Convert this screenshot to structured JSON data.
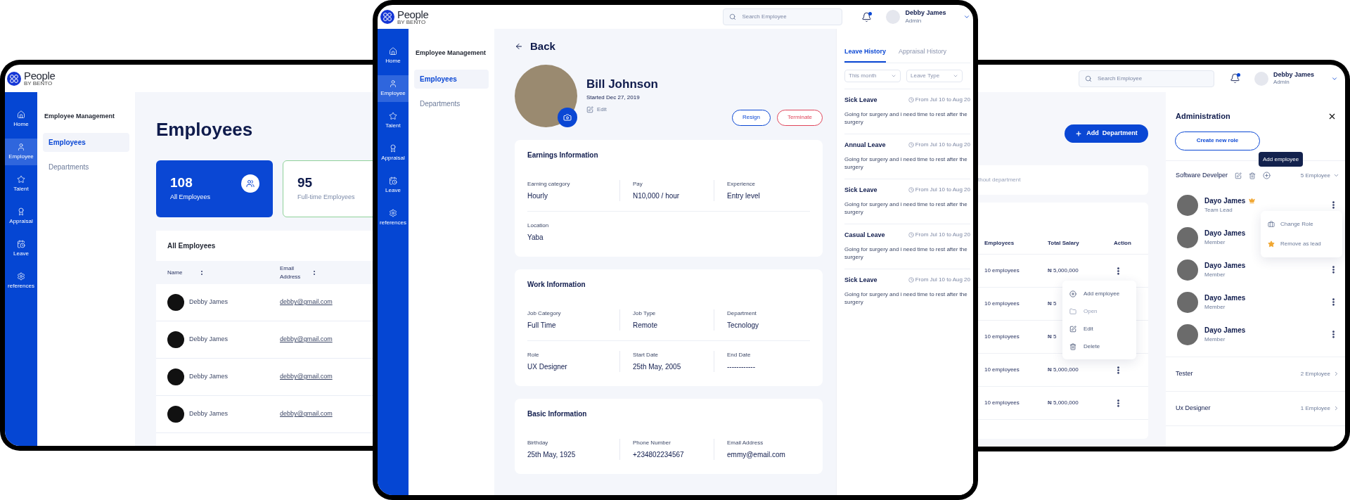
{
  "employees_screen": {
    "brand": {
      "name": "People",
      "tagline": "BY BENTO"
    },
    "nav": [
      {
        "label": "Home",
        "selected": false
      },
      {
        "label": "Employee",
        "selected": true
      },
      {
        "label": "Talent",
        "selected": false
      },
      {
        "label": "Appraisal",
        "selected": false
      },
      {
        "label": "Leave",
        "selected": false
      },
      {
        "label": "references",
        "selected": false
      }
    ],
    "subnav": {
      "title": "Employee Management",
      "items": [
        {
          "label": "Employees",
          "selected": true
        },
        {
          "label": "Departments",
          "selected": false
        }
      ]
    },
    "title": "Employees",
    "stats": [
      {
        "value": "108",
        "label": "All Employees",
        "kind": "primary"
      },
      {
        "value": "95",
        "label": "Full-time Employees",
        "kind": "outline"
      }
    ],
    "table": {
      "title": "All Employees",
      "columns": [
        "Name",
        "Email Address"
      ],
      "rows": [
        {
          "name": "Debby James",
          "email": "debby@gmail.com"
        },
        {
          "name": "Debby James",
          "email": "debby@gmail.com"
        },
        {
          "name": "Debby James",
          "email": "debby@gmail.com"
        },
        {
          "name": "Debby James",
          "email": "debby@gmail.com"
        }
      ]
    }
  },
  "profile_screen": {
    "brand": {
      "name": "People",
      "tagline": "BY BENTO"
    },
    "search": {
      "placeholder": "Search Employee"
    },
    "user": {
      "name": "Debby James",
      "role": "Admin",
      "notification": true
    },
    "nav": [
      {
        "label": "Home",
        "selected": false
      },
      {
        "label": "Employee",
        "selected": true
      },
      {
        "label": "Talent",
        "selected": false
      },
      {
        "label": "Appraisal",
        "selected": false
      },
      {
        "label": "Leave",
        "selected": false
      },
      {
        "label": "references",
        "selected": false
      }
    ],
    "subnav": {
      "title": "Employee Management",
      "items": [
        {
          "label": "Employees",
          "selected": true
        },
        {
          "label": "Departments",
          "selected": false
        }
      ]
    },
    "back": "Back",
    "profile": {
      "name": "Bill Johnson",
      "started": "Started Dec 27, 2019",
      "edit": "Edit"
    },
    "actions": [
      {
        "label": "Resign",
        "kind": "neutral"
      },
      {
        "label": "Terminate",
        "kind": "danger"
      }
    ],
    "sections": [
      {
        "title": "Earnings Information",
        "rows": [
          [
            {
              "label": "Earning category",
              "value": "Hourly"
            },
            {
              "label": "Pay",
              "value": "N10,000 / hour"
            },
            {
              "label": "Experience",
              "value": "Entry level"
            }
          ],
          [
            {
              "label": "Location",
              "value": "Yaba"
            }
          ]
        ]
      },
      {
        "title": "Work Information",
        "rows": [
          [
            {
              "label": "Job Category",
              "value": "Full Time"
            },
            {
              "label": "Job Type",
              "value": "Remote"
            },
            {
              "label": "Department",
              "value": "Tecnology"
            }
          ],
          [
            {
              "label": "Role",
              "value": "UX Designer"
            },
            {
              "label": "Start Date",
              "value": "25th May, 2005"
            },
            {
              "label": "End Date",
              "value": "------------"
            }
          ]
        ]
      },
      {
        "title": "Basic Information",
        "rows": [
          [
            {
              "label": "Birthday",
              "value": "25th May, 1925"
            },
            {
              "label": "Phone Number",
              "value": "+234802234567"
            },
            {
              "label": "Email Address",
              "value": "emmy@email.com"
            }
          ]
        ]
      }
    ],
    "history": {
      "tabs": [
        {
          "label": "Leave History",
          "selected": true
        },
        {
          "label": "Appraisal History",
          "selected": false
        }
      ],
      "filters": [
        {
          "placeholder": "This month"
        },
        {
          "placeholder": "Leave Type"
        }
      ],
      "entries": [
        {
          "type": "Sick Leave",
          "dates": "From Jul 10 to Aug 20",
          "note": "Going for surgery and i need time to rest after the surgery"
        },
        {
          "type": "Annual Leave",
          "dates": "From Jul 10 to Aug 20",
          "note": "Going for surgery and i need time to rest after the surgery"
        },
        {
          "type": "Sick Leave",
          "dates": "From Jul 10 to Aug 20",
          "note": "Going for surgery and i need time to rest after the surgery"
        },
        {
          "type": "Casual Leave",
          "dates": "From Jul 10 to Aug 20",
          "note": "Going for surgery and i need time to rest after the surgery"
        },
        {
          "type": "Sick Leave",
          "dates": "From Jul 10 to Aug 20",
          "note": "Going for surgery and i need time to rest after the surgery"
        }
      ]
    }
  },
  "departments_screen": {
    "search": {
      "placeholder": "Search Employee"
    },
    "user": {
      "name": "Debby James",
      "role": "Admin",
      "notification": true
    },
    "add_button": "Add  Department",
    "notice": "thout department",
    "table": {
      "columns": [
        "Employees",
        "Total Salary",
        "Action"
      ],
      "rows": [
        {
          "employees": "10 employees",
          "salary": "₦ 5,000,000"
        },
        {
          "employees": "10 employees",
          "salary": "₦ 5"
        },
        {
          "employees": "10 employees",
          "salary": "₦ 5"
        },
        {
          "employees": "10 employees",
          "salary": "₦ 5,000,000"
        },
        {
          "employees": "10 employees",
          "salary": "₦ 5,000,000"
        }
      ]
    },
    "row_menu": {
      "items": [
        {
          "label": "Add employee",
          "disabled": false
        },
        {
          "label": "Open",
          "disabled": true
        },
        {
          "label": "Edit",
          "disabled": false
        },
        {
          "label": "Delete",
          "disabled": false
        }
      ]
    },
    "admin": {
      "title": "Administration",
      "create_button": "Create new role",
      "tooltip": "Add employee",
      "roles": [
        {
          "name": "Software Develper",
          "count": "5 Employee",
          "expanded": true,
          "members": [
            {
              "name": "Dayo James",
              "role": "Team Lead",
              "lead": true
            },
            {
              "name": "Dayo James",
              "role": "Member",
              "lead": false
            },
            {
              "name": "Dayo James",
              "role": "Member",
              "lead": false
            },
            {
              "name": "Dayo James",
              "role": "Member",
              "lead": false
            },
            {
              "name": "Dayo James",
              "role": "Member",
              "lead": false
            }
          ]
        },
        {
          "name": "Tester",
          "count": "2 Employee",
          "expanded": false
        },
        {
          "name": "Ux Designer",
          "count": "1 Employee",
          "expanded": false
        }
      ],
      "member_menu": {
        "items": [
          {
            "label": "Change Role"
          },
          {
            "label": "Remove as lead"
          }
        ]
      }
    }
  }
}
